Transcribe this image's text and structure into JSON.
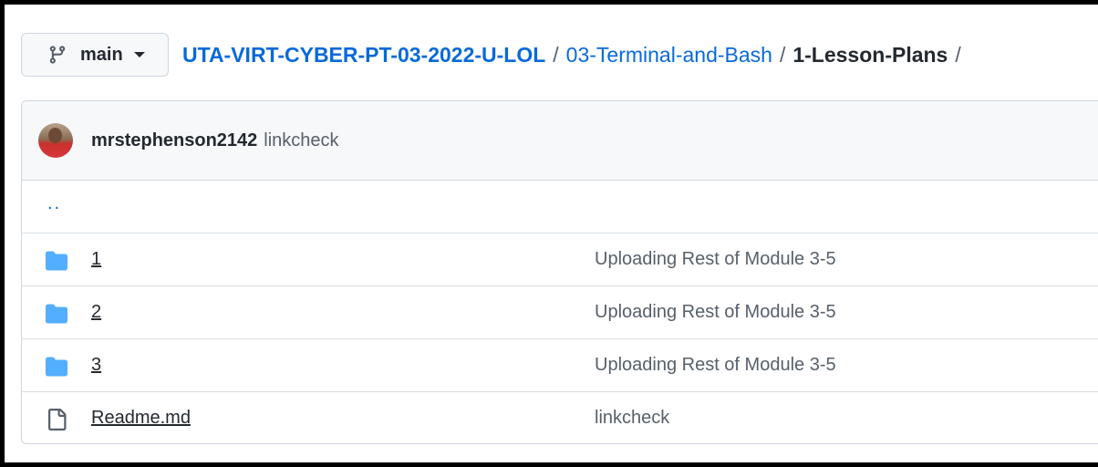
{
  "branch": {
    "label": "main",
    "icon": "git-branch-icon"
  },
  "breadcrumb": {
    "repo": "UTA-VIRT-CYBER-PT-03-2022-U-LOL",
    "folder": "03-Terminal-and-Bash",
    "current": "1-Lesson-Plans",
    "separator": "/"
  },
  "commit": {
    "author": "mrstephenson2142",
    "message": "linkcheck"
  },
  "parent_link": "..",
  "files": [
    {
      "name": "1",
      "type": "folder",
      "icon": "folder-icon",
      "message": "Uploading Rest of Module 3-5"
    },
    {
      "name": "2",
      "type": "folder",
      "icon": "folder-icon",
      "message": "Uploading Rest of Module 3-5"
    },
    {
      "name": "3",
      "type": "folder",
      "icon": "folder-icon",
      "message": "Uploading Rest of Module 3-5"
    },
    {
      "name": "Readme.md",
      "type": "file",
      "icon": "file-icon",
      "message": "linkcheck"
    }
  ],
  "colors": {
    "link": "#0969da",
    "folder": "#54aeff",
    "text": "#24292f",
    "muted": "#57606a"
  }
}
